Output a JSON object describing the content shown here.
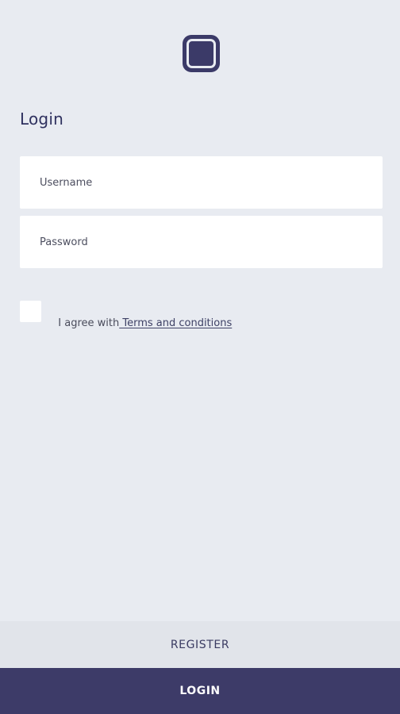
{
  "header": {
    "title": "Login"
  },
  "form": {
    "username_placeholder": "Username",
    "password_placeholder": "Password",
    "agree_prefix": "I agree with",
    "terms_link": " Terms and conditions"
  },
  "actions": {
    "register_label": "REGISTER",
    "login_label": "LOGIN"
  },
  "colors": {
    "background": "#e8ebf1",
    "brand": "#3d3b68",
    "title": "#2f315f"
  },
  "icons": {
    "logo": "app-logo-icon"
  }
}
